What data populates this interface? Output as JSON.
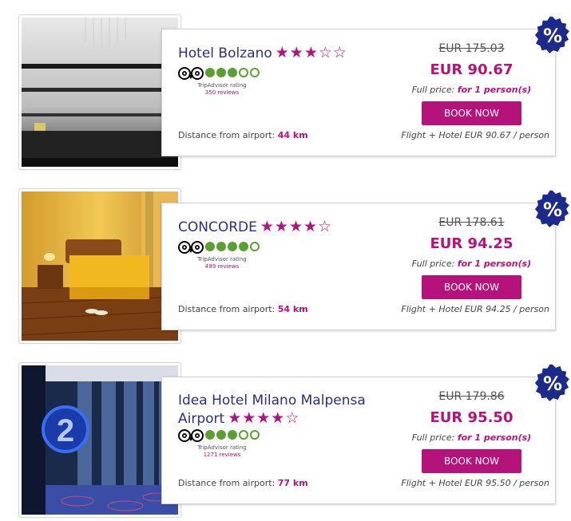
{
  "colors": {
    "accent": "#b6127c",
    "hotel_name": "#2b2e86",
    "tripadvisor_green": "#5aa132",
    "badge_blue": "#1c2a8c"
  },
  "hotels": [
    {
      "name": "Hotel Bolzano",
      "stars": 3,
      "star_text": "★★★☆☆",
      "photo": "hotel-lobby-photo",
      "tripadvisor": {
        "label": "TripAdvisor rating",
        "bubbles": 3,
        "reviews": "350 reviews"
      },
      "distance_label": "Distance from airport:",
      "distance_value": "44 km",
      "old_price": "EUR 175.03",
      "new_price": "EUR 90.67",
      "full_price_label": "Full price:",
      "full_price_persons": "for 1 person(s)",
      "book_label": "BOOK NOW",
      "flight_hotel": "Flight + Hotel EUR 90.67 / person",
      "badge": "%"
    },
    {
      "name": "CONCORDE",
      "stars": 4,
      "star_text": "★★★★☆",
      "photo": "hotel-bedroom-photo",
      "tripadvisor": {
        "label": "TripAdvisor rating",
        "bubbles": 4,
        "reviews": "499 reviews"
      },
      "distance_label": "Distance from airport:",
      "distance_value": "54 km",
      "old_price": "EUR 178.61",
      "new_price": "EUR 94.25",
      "full_price_label": "Full price:",
      "full_price_persons": "for 1 person(s)",
      "book_label": "BOOK NOW",
      "flight_hotel": "Flight + Hotel EUR 94.25 / person",
      "badge": "%"
    },
    {
      "name": "Idea Hotel Milano Malpensa Airport",
      "stars": 4,
      "star_text": "★★★★☆",
      "photo": "hotel-corridor-photo",
      "tripadvisor": {
        "label": "TripAdvisor rating",
        "bubbles": 3,
        "reviews": "1271 reviews"
      },
      "distance_label": "Distance from airport:",
      "distance_value": "77 km",
      "old_price": "EUR 179.86",
      "new_price": "EUR 95.50",
      "full_price_label": "Full price:",
      "full_price_persons": "for 1 person(s)",
      "book_label": "BOOK NOW",
      "flight_hotel": "Flight + Hotel EUR 95.50 / person",
      "badge": "%"
    }
  ]
}
